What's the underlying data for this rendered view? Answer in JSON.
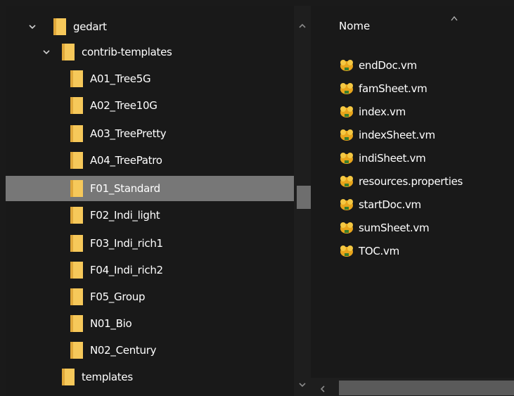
{
  "tree": {
    "items": [
      {
        "label": "gedart",
        "expanded": true
      },
      {
        "label": "contrib-templates",
        "expanded": true
      },
      {
        "label": "A01_Tree5G"
      },
      {
        "label": "A02_Tree10G"
      },
      {
        "label": "A03_TreePretty"
      },
      {
        "label": "A04_TreePatro"
      },
      {
        "label": "F01_Standard",
        "selected": true
      },
      {
        "label": "F02_Indi_light"
      },
      {
        "label": "F03_Indi_rich1"
      },
      {
        "label": "F04_Indi_rich2"
      },
      {
        "label": "F05_Group"
      },
      {
        "label": "N01_Bio"
      },
      {
        "label": "N02_Century"
      },
      {
        "label": "templates"
      }
    ]
  },
  "files": {
    "column_header": "Nome",
    "items": [
      {
        "label": "endDoc.vm"
      },
      {
        "label": "famSheet.vm"
      },
      {
        "label": "index.vm"
      },
      {
        "label": "indexSheet.vm"
      },
      {
        "label": "indiSheet.vm"
      },
      {
        "label": "resources.properties"
      },
      {
        "label": "startDoc.vm"
      },
      {
        "label": "sumSheet.vm"
      },
      {
        "label": "TOC.vm"
      }
    ]
  },
  "colors": {
    "background": "#191919",
    "selected_row": "#777777",
    "folder_yellow": "#f6c85a",
    "text": "#ffffff"
  }
}
